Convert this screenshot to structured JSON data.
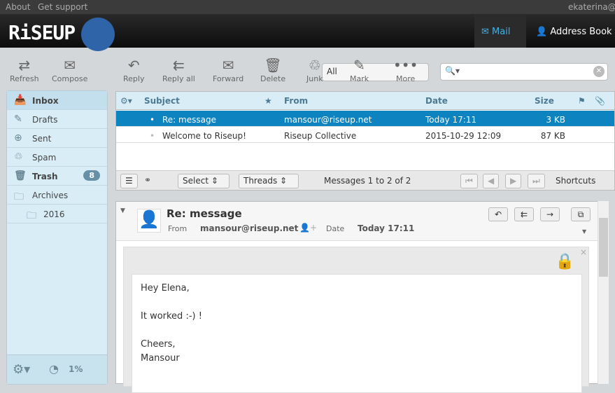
{
  "topbar": {
    "about": "About",
    "support": "Get support",
    "user": "ekaterina@r"
  },
  "header": {
    "logo": "RiSEUP",
    "mail": "Mail",
    "address_book": "Address Book"
  },
  "toolbar": {
    "refresh": "Refresh",
    "compose": "Compose",
    "reply": "Reply",
    "reply_all": "Reply all",
    "forward": "Forward",
    "delete": "Delete",
    "junk": "Junk",
    "filter": "All",
    "mark": "Mark",
    "more": "More"
  },
  "sidebar": {
    "folders": [
      {
        "label": "Inbox"
      },
      {
        "label": "Drafts"
      },
      {
        "label": "Sent"
      },
      {
        "label": "Spam"
      },
      {
        "label": "Trash",
        "count": "8"
      },
      {
        "label": "Archives"
      },
      {
        "label": "2016"
      }
    ],
    "quota": "1%"
  },
  "list": {
    "columns": {
      "subject": "Subject",
      "from": "From",
      "date": "Date",
      "size": "Size"
    },
    "rows": [
      {
        "subject": "Re: message",
        "from": "mansour@riseup.net",
        "date": "Today 17:11",
        "size": "3 KB"
      },
      {
        "subject": "Welcome to Riseup!",
        "from": "Riseup Collective",
        "date": "2015-10-29 12:09",
        "size": "87 KB"
      }
    ],
    "select": "Select",
    "threads": "Threads",
    "count": "Messages 1 to 2 of 2",
    "shortcuts": "Shortcuts"
  },
  "message": {
    "subject": "Re: message",
    "from_label": "From",
    "from": "mansour@riseup.net",
    "date_label": "Date",
    "date": "Today 17:11",
    "body": [
      "Hey Elena,",
      "It worked :-) !",
      "Cheers,",
      "Mansour"
    ]
  }
}
